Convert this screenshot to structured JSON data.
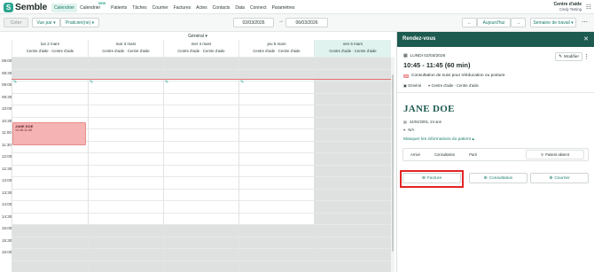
{
  "app": {
    "brand": "Semble",
    "brand_mark": "S"
  },
  "nav": {
    "items": [
      "Calendrier",
      "Calendrier",
      "Patients",
      "Tâches",
      "Courrier",
      "Factures",
      "Actes",
      "Contacts",
      "Data",
      "Connect",
      "Paramètres"
    ],
    "badge": "NEW"
  },
  "account": {
    "name": "Centre d'aide",
    "user": "Cindy Testing"
  },
  "toolbar": {
    "create": "Créer",
    "view_by": "Vue par ▾",
    "practitioners": "Praticien(ne) ▾",
    "start_date": "02/03/2026",
    "end_date": "06/03/2026",
    "separator": "→",
    "prev": "←",
    "today": "Aujourd'hui",
    "next": "→",
    "week_view": "Semaine de travail ▾",
    "more": "⋯"
  },
  "calendar": {
    "general": "Général ▾",
    "days": [
      {
        "name": "lun 2 mars",
        "place": "Centre d'aide · Centre d'aide"
      },
      {
        "name": "mar 3 mars",
        "place": "Centre d'aide · Centre d'aide"
      },
      {
        "name": "mer 4 mars",
        "place": "Centre d'aide · Centre d'aide"
      },
      {
        "name": "jeu 5 mars",
        "place": "Centre d'aide · Centre d'aide"
      },
      {
        "name": "ven 6 mars",
        "place": "Centre d'aide · Centre d'aide"
      }
    ],
    "times": [
      "08:00",
      "08:30",
      "09:00",
      "09:30",
      "10:00",
      "10:30",
      "11:00",
      "11:30",
      "12:00",
      "12:30",
      "13:00",
      "13:30",
      "14:00",
      "14:30",
      "15:00",
      "15:30",
      "16:00"
    ],
    "appointment": {
      "name": "JANE DOE",
      "time": "10:45-11:45"
    }
  },
  "panel": {
    "title": "Rendez-vous",
    "date": "LUNDI 02/03/2026",
    "time_range": "10:45 - 11:45 (60 min)",
    "edit": "Modifier",
    "appt_type": "Consultation de suivi pour rééducation ou posture",
    "tag_general": "Général",
    "tag_location": "Centre d'aide - Centre d'aide",
    "patient": "JANE DOE",
    "dob": "24/04/2001, 24 ans",
    "phone": "N/A",
    "show_info": "Masquer les informations du patient ▴",
    "statuses": [
      "Arrivé",
      "Consultation",
      "Parti"
    ],
    "absent": "Patient absent",
    "actions": {
      "invoice": "Facture",
      "consultation": "Consultation",
      "mail": "Courrier"
    }
  },
  "colors": {
    "accent": "#2aa58f",
    "panel_header": "#1d5a50",
    "appointment": "#f6b3b3",
    "highlight": "#e32525"
  }
}
